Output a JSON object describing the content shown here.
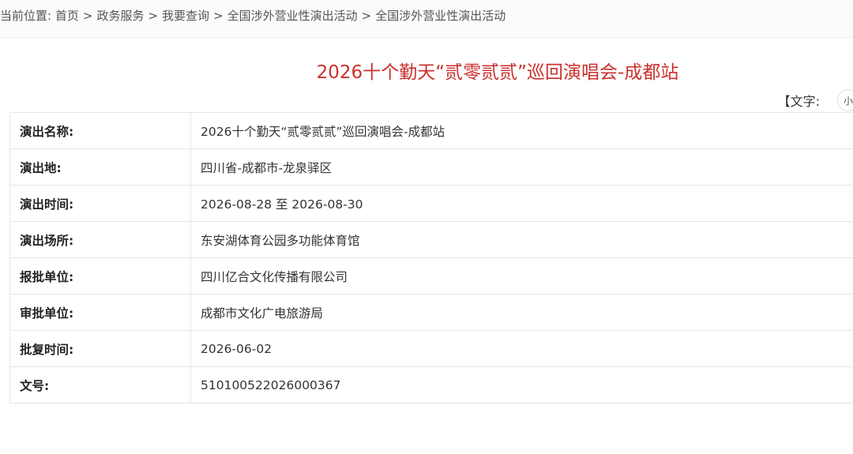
{
  "breadcrumb": {
    "prefix": "当前位置:",
    "items": [
      "首页",
      "政务服务",
      "我要查询",
      "全国涉外营业性演出活动",
      "全国涉外营业性演出活动"
    ],
    "separator": ">"
  },
  "article": {
    "title": "2026十个勤天“贰零贰贰”巡回演唱会-成都站"
  },
  "font_size_control": {
    "label": "【文字:",
    "small": "小"
  },
  "details": [
    {
      "key": "演出名称:",
      "value": "2026十个勤天“贰零贰贰”巡回演唱会-成都站"
    },
    {
      "key": "演出地:",
      "value": "四川省-成都市-龙泉驿区"
    },
    {
      "key": "演出时间:",
      "value": "2026-08-28 至 2026-08-30"
    },
    {
      "key": "演出场所:",
      "value": "东安湖体育公园多功能体育馆"
    },
    {
      "key": "报批单位:",
      "value": "四川亿合文化传播有限公司"
    },
    {
      "key": "审批单位:",
      "value": "成都市文化广电旅游局"
    },
    {
      "key": "批复时间:",
      "value": "2026-06-02"
    },
    {
      "key": "文号:",
      "value": "510100522026000367"
    }
  ],
  "colors": {
    "title": "#c9302c",
    "border": "#e6e6e6"
  }
}
